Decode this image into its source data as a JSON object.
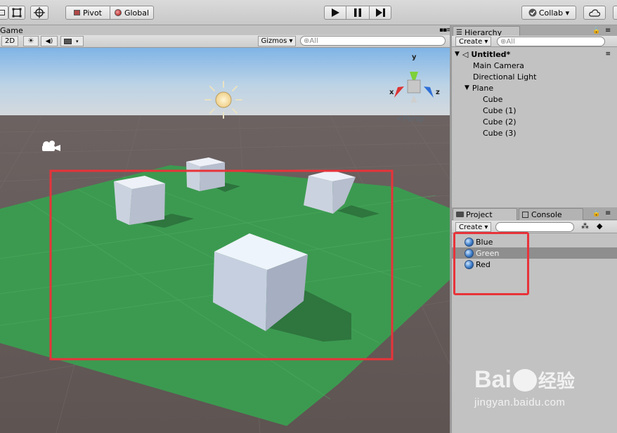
{
  "toolbar": {
    "pivot_label": "Pivot",
    "global_label": "Global",
    "collab_label": "Collab ▾",
    "play_icon": "play-icon",
    "pause_icon": "pause-icon",
    "step_icon": "step-icon"
  },
  "scene": {
    "tab_label": "Game",
    "btn_2d": "2D",
    "gizmos_label": "Gizmos ▾",
    "search_placeholder": "⊕All",
    "persp_label": "<Persp",
    "gizmo_y": "y",
    "gizmo_x": "x",
    "gizmo_z": "z",
    "highlight_color": "#e8333a",
    "plane_color": "#3f9b52"
  },
  "hierarchy": {
    "tab_label": "Hierarchy",
    "create_label": "Create ▾",
    "search_placeholder": "⊕All",
    "scene_name": "Untitled*",
    "items": [
      {
        "label": "Main Camera"
      },
      {
        "label": "Directional Light"
      },
      {
        "label": "Plane"
      },
      {
        "label": "Cube"
      },
      {
        "label": "Cube (1)"
      },
      {
        "label": "Cube (2)"
      },
      {
        "label": "Cube (3)"
      }
    ]
  },
  "project": {
    "tab_label": "Project",
    "console_label": "Console",
    "create_label": "Create ▾",
    "materials": [
      {
        "label": "Blue",
        "selected": false
      },
      {
        "label": "Green",
        "selected": true
      },
      {
        "label": "Red",
        "selected": false
      }
    ]
  },
  "watermark": {
    "brand": "Bai",
    "brand2": "经验",
    "url": "jingyan.baidu.com"
  }
}
